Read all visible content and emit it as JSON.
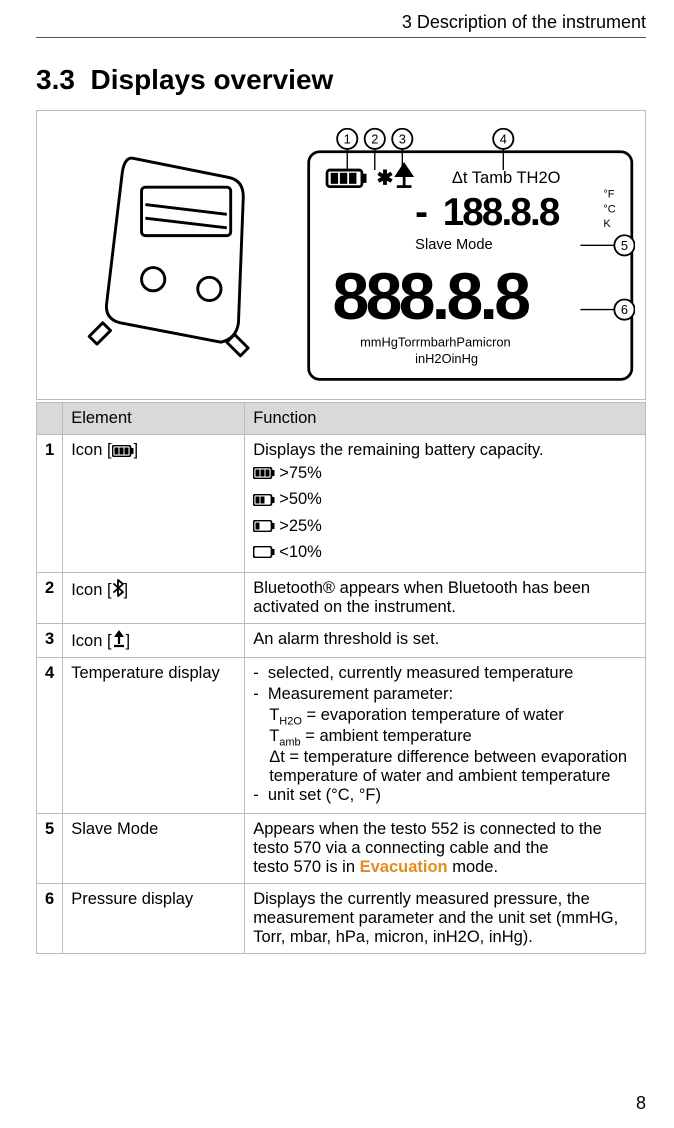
{
  "header": {
    "chapter": "3 Description of the instrument"
  },
  "section": {
    "number": "3.3",
    "title": "Displays overview"
  },
  "figure": {
    "callouts": [
      "1",
      "2",
      "3",
      "4",
      "5",
      "6"
    ],
    "slave_mode_label": "Slave Mode",
    "temp_labels": "Δt Tamb TH2O",
    "temp_units": [
      "°F",
      "°C",
      "K"
    ],
    "small_digits": "188.8.8",
    "big_digits": "888.8.8",
    "units_line1": "mmHgTorrmbarhPamicron",
    "units_line2": "inH2OinHg"
  },
  "table": {
    "headers": {
      "element": "Element",
      "function": "Function"
    },
    "rows": [
      {
        "num": "1",
        "element_prefix": "Icon [",
        "element_suffix": "]",
        "element_icon": "battery-full-icon",
        "function_main": "Displays the remaining battery capacity.",
        "levels": [
          {
            "icon": "battery-full-icon",
            "text": ">75%"
          },
          {
            "icon": "battery-75-icon",
            "text": ">50%"
          },
          {
            "icon": "battery-50-icon",
            "text": ">25%"
          },
          {
            "icon": "battery-25-icon",
            "text": "<10%"
          }
        ]
      },
      {
        "num": "2",
        "element_prefix": "Icon [",
        "element_suffix": "]",
        "element_icon": "bluetooth-icon",
        "function_main": "Bluetooth® appears when Bluetooth has been activated on the instrument."
      },
      {
        "num": "3",
        "element_prefix": "Icon [",
        "element_suffix": "]",
        "element_icon": "alarm-icon",
        "function_main": "An alarm threshold is set."
      },
      {
        "num": "4",
        "element": "Temperature display",
        "bullets": [
          "selected, currently measured temperature",
          "Measurement parameter:"
        ],
        "sub_lines": [
          {
            "sym": "T",
            "sub": "H2O",
            "rest": " = evaporation temperature of water"
          },
          {
            "sym": "T",
            "sub": "amb",
            "rest": " = ambient temperature"
          }
        ],
        "delta_line": "Δt = temperature difference between evaporation temperature of water and ambient temperature",
        "bullet3": "unit set (°C, °F)"
      },
      {
        "num": "5",
        "element": "Slave Mode",
        "line_a": "Appears when the testo 552 is connected to the testo 570 via a connecting cable and the",
        "line_b_pre": "testo 570 is in ",
        "line_b_em": "Evacuation",
        "line_b_post": " mode."
      },
      {
        "num": "6",
        "element": "Pressure display",
        "function_main": "Displays the currently measured pressure, the measurement parameter and the unit set (mmHG, Torr, mbar, hPa, micron, inH2O, inHg)."
      }
    ]
  },
  "page_number": "8"
}
